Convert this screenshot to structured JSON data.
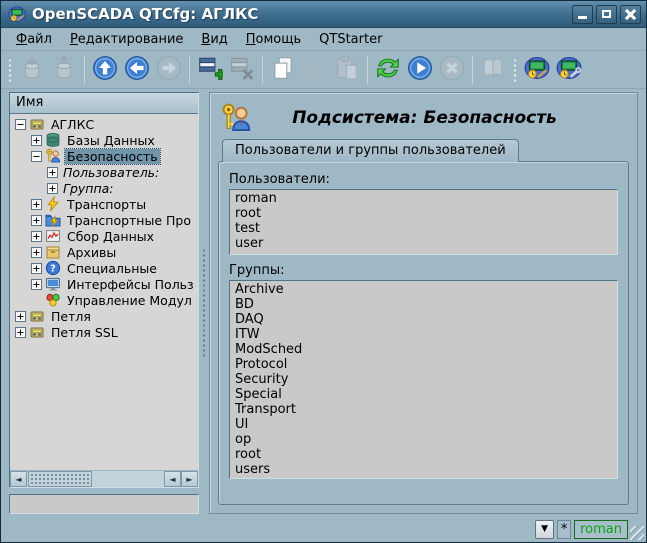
{
  "window": {
    "title": "OpenSCADA QTCfg: АГЛКС",
    "icon": "openscada-app-icon",
    "controls": [
      "minimize",
      "maximize",
      "close"
    ]
  },
  "menu": {
    "items": [
      {
        "label": "Файл",
        "underline_first": true
      },
      {
        "label": "Редактирование",
        "underline_first": true
      },
      {
        "label": "Вид",
        "underline_first": true
      },
      {
        "label": "Помощь",
        "underline_first": true
      },
      {
        "label": "QTStarter",
        "underline_first": false
      }
    ]
  },
  "toolbar": {
    "groups": [
      {
        "handle": true,
        "sep_after": true,
        "icons": [
          {
            "name": "load-from-db-icon",
            "disabled": true
          },
          {
            "name": "save-to-db-icon",
            "disabled": true
          }
        ]
      },
      {
        "sep_after": true,
        "icons": [
          {
            "name": "nav-up-icon",
            "disabled": false
          },
          {
            "name": "nav-back-icon",
            "disabled": false
          },
          {
            "name": "nav-forward-icon",
            "disabled": true
          }
        ]
      },
      {
        "sep_after": true,
        "icons": [
          {
            "name": "add-item-icon",
            "disabled": false
          },
          {
            "name": "remove-item-icon",
            "disabled": true
          }
        ]
      },
      {
        "sep_after": true,
        "icons": [
          {
            "name": "copy-item-icon",
            "disabled": false
          },
          {
            "name": "cut-item-icon",
            "disabled": true
          },
          {
            "name": "paste-item-icon",
            "disabled": true
          }
        ]
      },
      {
        "sep_after": true,
        "icons": [
          {
            "name": "refresh-icon",
            "disabled": false
          },
          {
            "name": "start-icon",
            "disabled": false
          },
          {
            "name": "stop-icon",
            "disabled": true
          }
        ]
      },
      {
        "sep_after": false,
        "icons": [
          {
            "name": "manual-icon",
            "disabled": true
          }
        ]
      },
      {
        "handle": true,
        "sep_after": false,
        "icons": [
          {
            "name": "qtcfg-app-icon",
            "disabled": false
          },
          {
            "name": "qtstarter-config-icon",
            "disabled": false
          }
        ]
      }
    ]
  },
  "tree": {
    "header": "Имя",
    "items": [
      {
        "label": "АГЛКС",
        "depth": 0,
        "expander": "minus",
        "icon": "station-icon",
        "selected": false,
        "italic": false
      },
      {
        "label": "Базы Данных",
        "depth": 1,
        "expander": "plus",
        "icon": "database-icon",
        "selected": false,
        "italic": false
      },
      {
        "label": "Безопасность",
        "depth": 1,
        "expander": "minus",
        "icon": "security-icon",
        "selected": true,
        "italic": false
      },
      {
        "label": "Пользователь:",
        "depth": 2,
        "expander": "plus",
        "icon": null,
        "selected": false,
        "italic": true
      },
      {
        "label": "Группа:",
        "depth": 2,
        "expander": "plus",
        "icon": null,
        "selected": false,
        "italic": true
      },
      {
        "label": "Транспорты",
        "depth": 1,
        "expander": "plus",
        "icon": "transport-icon",
        "selected": false,
        "italic": false
      },
      {
        "label": "Транспортные Про",
        "depth": 1,
        "expander": "plus",
        "icon": "transport-protocol-icon",
        "selected": false,
        "italic": false
      },
      {
        "label": "Сбор Данных",
        "depth": 1,
        "expander": "plus",
        "icon": "daq-icon",
        "selected": false,
        "italic": false
      },
      {
        "label": "Архивы",
        "depth": 1,
        "expander": "plus",
        "icon": "archive-icon",
        "selected": false,
        "italic": false
      },
      {
        "label": "Специальные",
        "depth": 1,
        "expander": "plus",
        "icon": "special-icon",
        "selected": false,
        "italic": false
      },
      {
        "label": "Интерфейсы Польз",
        "depth": 1,
        "expander": "plus",
        "icon": "ui-icon",
        "selected": false,
        "italic": false
      },
      {
        "label": "Управление Модул",
        "depth": 1,
        "expander": "none",
        "icon": "modules-icon",
        "selected": false,
        "italic": false
      },
      {
        "label": "Петля",
        "depth": 0,
        "expander": "plus",
        "icon": "station-icon",
        "selected": false,
        "italic": false
      },
      {
        "label": "Петля SSL",
        "depth": 0,
        "expander": "plus",
        "icon": "station-icon",
        "selected": false,
        "italic": false
      }
    ],
    "filter_value": ""
  },
  "main": {
    "icon": "security-subsystem-icon",
    "title": "Подсистема: Безопасность",
    "tab_label": "Пользователи и группы пользователей",
    "users_label": "Пользователи:",
    "users": [
      "roman",
      "root",
      "test",
      "user"
    ],
    "groups_label": "Группы:",
    "groups": [
      "Archive",
      "BD",
      "DAQ",
      "ITW",
      "ModSched",
      "Protocol",
      "Security",
      "Special",
      "Transport",
      "UI",
      "op",
      "root",
      "users"
    ]
  },
  "statusbar": {
    "dropdown_glyph": "▼",
    "asterisk": "*",
    "user": "roman"
  },
  "colors": {
    "window_bg": "#9fb8c6",
    "titlebar": "#3d6b8c",
    "tree_bg": "#d6d6d6",
    "list_bg": "#c9c9c9",
    "selection": "#7295aa",
    "user_green": "#13a013"
  }
}
